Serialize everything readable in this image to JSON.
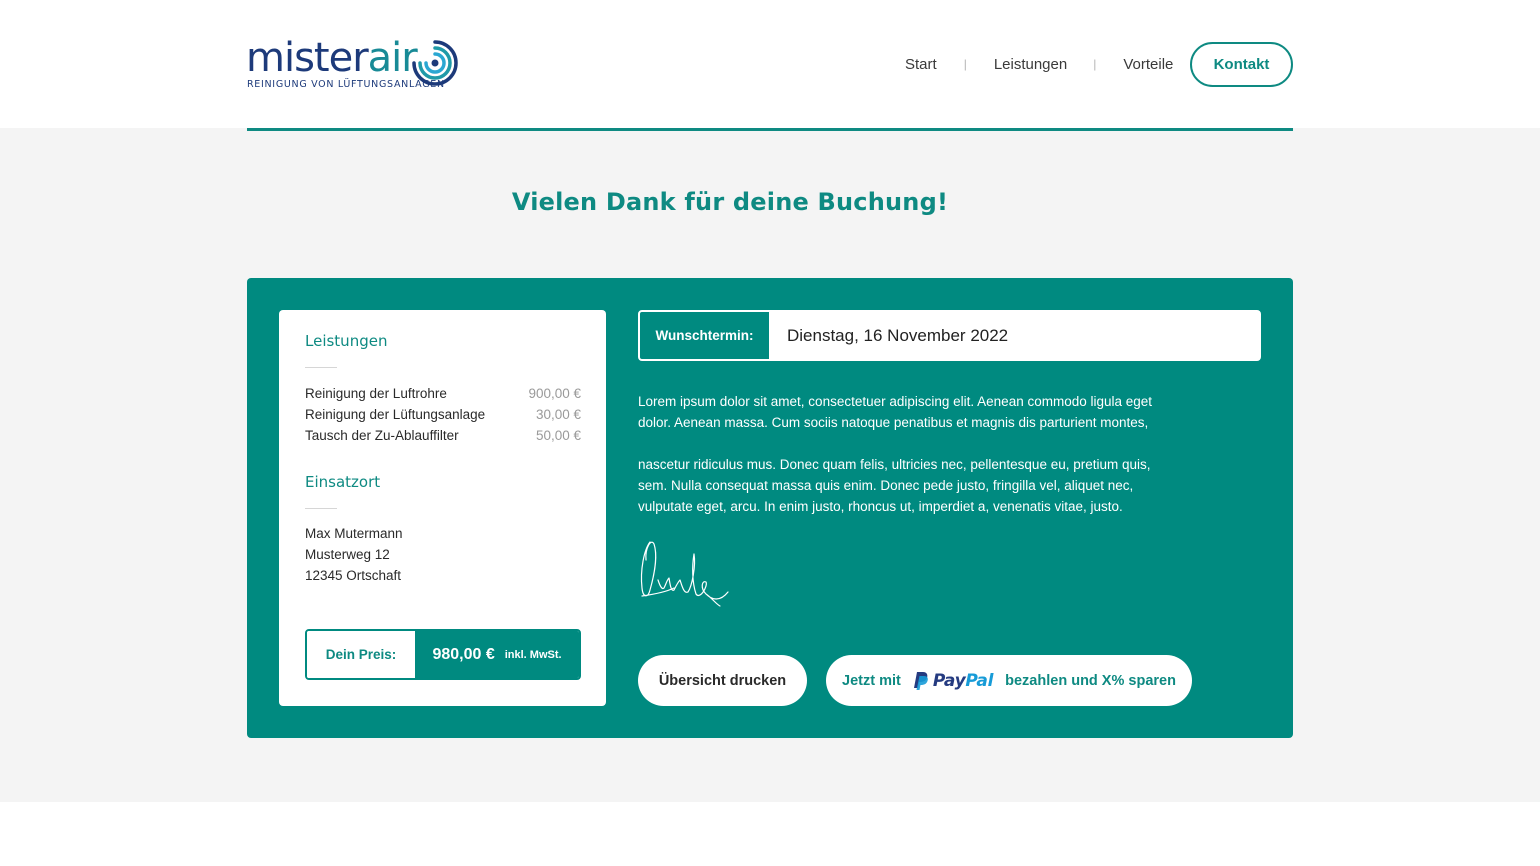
{
  "header": {
    "logo": {
      "word_part1": "mister",
      "word_part2": "air",
      "tagline": "REINIGUNG VON LÜFTUNGSANLAGEN"
    },
    "nav": [
      {
        "label": "Start"
      },
      {
        "label": "Leistungen"
      },
      {
        "label": "Vorteile"
      }
    ],
    "contact_button": "Kontakt"
  },
  "page": {
    "title": "Vielen Dank für deine Buchung!"
  },
  "summary": {
    "services_heading": "Leistungen",
    "services": [
      {
        "name": "Reinigung der Luftrohre",
        "price": "900,00 €"
      },
      {
        "name": "Reinigung der Lüftungsanlage",
        "price": "30,00 €"
      },
      {
        "name": "Tausch der Zu-Ablauffilter",
        "price": "50,00 €"
      }
    ],
    "location_heading": "Einsatzort",
    "address": {
      "name": "Max Mutermann",
      "street": "Musterweg 12",
      "city": "12345 Ortschaft"
    },
    "price": {
      "label": "Dein Preis:",
      "amount": "980,00 €",
      "tax_note": "inkl. MwSt."
    }
  },
  "appointment": {
    "label": "Wunschtermin:",
    "date": "Dienstag, 16 November 2022"
  },
  "message": {
    "paragraph1": "Lorem ipsum dolor sit amet, consectetuer adipiscing elit. Aenean commodo ligula eget dolor. Aenean massa. Cum sociis natoque penatibus et magnis dis parturient montes,",
    "paragraph2": "nascetur ridiculus mus. Donec quam felis, ultricies nec, pellentesque eu, pretium quis, sem. Nulla consequat massa quis enim. Donec pede justo, fringilla vel, aliquet nec, vulputate eget, arcu. In enim justo, rhoncus ut, imperdiet a, venenatis vitae, justo."
  },
  "actions": {
    "print_label": "Übersicht drucken",
    "paypal_prefix": "Jetzt mit",
    "paypal_brand_part1": "Pay",
    "paypal_brand_part2": "Pal",
    "paypal_suffix": "bezahlen und X% sparen"
  },
  "colors": {
    "brand_teal": "#008a80",
    "brand_navy": "#1d3a7a",
    "background_grey": "#f4f4f4",
    "paypal_dark_blue": "#253b80",
    "paypal_light_blue": "#179bd7"
  },
  "icons": {
    "logo_swirl": "swirl-icon",
    "signature": "signature-image",
    "paypal": "paypal-icon"
  }
}
